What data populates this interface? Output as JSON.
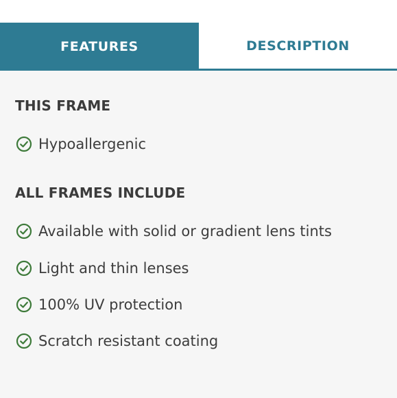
{
  "tabs": [
    {
      "label": "FEATURES",
      "active": true
    },
    {
      "label": "DESCRIPTION",
      "active": false
    }
  ],
  "this_frame": {
    "heading": "THIS FRAME",
    "items": [
      "Hypoallergenic"
    ]
  },
  "all_frames": {
    "heading": "ALL FRAMES INCLUDE",
    "items": [
      "Available with solid or gradient lens tints",
      "Light and thin lenses",
      "100% UV protection",
      "Scratch resistant coating"
    ]
  },
  "icons": {
    "check": "check-circle-icon"
  },
  "colors": {
    "accent": "#2e7b93",
    "check": "#3e7a3a",
    "panel_bg": "#f6f6f6",
    "text": "#3d3d3d"
  }
}
